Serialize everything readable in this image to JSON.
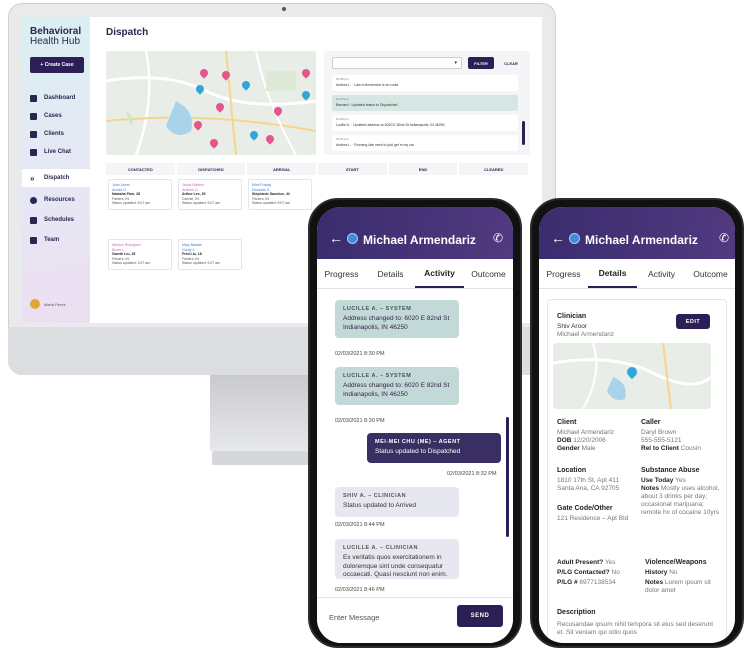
{
  "app": {
    "brand_line1": "Behavioral",
    "brand_line2": "Health Hub",
    "create_case": "+ Create Case",
    "nav": [
      "Dashboard",
      "Cases",
      "Clients",
      "Live Chat",
      "Dispatch",
      "Resources",
      "Schedules",
      "Team"
    ],
    "user_name": "Maria Perez",
    "page_title": "Dispatch",
    "filter_btn": "FILTER",
    "clear_btn": "CLEAR",
    "log": [
      {
        "time": "10:35 pm",
        "msg": "Andrea L. · Law enforcement is en route"
      },
      {
        "time": "10:34 pm",
        "msg": "Bernard · Updated status to Dispatched"
      },
      {
        "time": "10:33 pm",
        "msg": "Lucille A. · Updated address to 6020 E 82nd St Indianapolis, IN 46250"
      },
      {
        "time": "10:31 pm",
        "msg": "Andrea L. · Running late need to just get in my car"
      }
    ],
    "statuses": [
      "CONTACTED",
      "DISPATCHED",
      "ARRIVAL",
      "START",
      "END",
      "CLEARED"
    ],
    "cards": [
      {
        "l1": "John Jones",
        "l2": "Arnold O.",
        "name": "Natasha Pion, 28",
        "city": "Fishers, IN",
        "status": "Status updated: 5:07 am"
      },
      {
        "l1": "Jacob Winters",
        "l2": "Andrew O.",
        "name": "Arthur Lee, 30",
        "city": "Carmel, IN",
        "status": "Status updated: 5:07 am"
      },
      {
        "l1": "Mimi Fostag",
        "l2": "Edwards G.",
        "name": "Stephanie Sanchez, 44",
        "city": "Fishers, IN",
        "status": "Status updated: 5:07 am"
      },
      {
        "l1": "Weston Rodriguez",
        "l2": "Bruce L.",
        "name": "Gareth Liu, 25",
        "city": "Fishers, IN",
        "status": "Status updated: 3:07 am"
      },
      {
        "l1": "Mary Balaski",
        "l2": "Gordy J.",
        "name": "Fred Liu, 18",
        "city": "Fishers, IN",
        "status": "Status updated: 5:07 am"
      }
    ]
  },
  "phone1": {
    "name": "Michael Armendariz",
    "tabs": [
      "Progress",
      "Details",
      "Activity",
      "Outcome"
    ],
    "messages": [
      {
        "header": "LUCILLE A. – SYSTEM",
        "body": "Address changed to: 6020 E 82nd St Indianapolis, IN 46250",
        "ts": "02/03/2021 8:30 PM"
      },
      {
        "header": "LUCILLE A. – SYSTEM",
        "body": "Address changed to: 6020 E 82nd St Indianapolis, IN 46250",
        "ts": "02/03/2021 8:30 PM"
      },
      {
        "header": "MEI-MEI CHU (ME) – AGENT",
        "body": "Status updated to Dispatched",
        "ts": "02/03/2021 8:32 PM"
      },
      {
        "header": "SHIV A. – CLINICIAN",
        "body": "Status updated to Arrived",
        "ts": "02/03/2021 8:44 PM"
      },
      {
        "header": "LUCILLE A. – CLINICIAN",
        "body": "Ex veritatis quos exercitationem in doloremque sint unde consequatur occaecati. Quasi nesciunt non enim.",
        "ts": "02/03/2021 8:46 PM"
      }
    ],
    "input_placeholder": "Enter Message",
    "send": "SEND"
  },
  "phone2": {
    "name": "Michael Armendariz",
    "tabs": [
      "Progress",
      "Details",
      "Activity",
      "Outcome"
    ],
    "clinician_label": "Clinician",
    "clinician_name": "Shiv Aroor",
    "clinician_client": "Michael Armendariz",
    "edit": "EDIT",
    "client_label": "Client",
    "client_name": "Michael Armendariz",
    "dob_label": "DOB",
    "dob": "12/20/2006",
    "gender_label": "Gender",
    "gender": "Male",
    "caller_label": "Caller",
    "caller_name": "Daryl Brown",
    "caller_phone": "555-555-5121",
    "rel_label": "Rel to Client",
    "rel": "Cousin",
    "location_label": "Location",
    "location": "1810 17th St, Apt 411 Santa Ana, CA 92705",
    "gate_label": "Gate Code/Other",
    "gate": "121 Residence – Apt Bld",
    "substance_label": "Substance Abuse",
    "use_today_label": "Use Today",
    "use_today": "Yes",
    "notes_label": "Notes",
    "substance_notes": "Mostly uses alcohol, about 3 drinks per day; occasional marijuana; remote hx of cocaine 10yrs",
    "adult_label": "Adult Present?",
    "adult": "Yes",
    "plg_contacted_label": "P/LG Contacted?",
    "plg_contacted": "No",
    "plg_num_label": "P/LG #",
    "plg_num": "6977138534",
    "violence_label": "Violence/Weapons",
    "history_label": "History",
    "history": "No",
    "violence_notes": "Lorem ipsum sit dolor amet",
    "description_label": "Description",
    "description": "Recusandae ipsum nihil tempora sit eius sed deserunt et. Sit veniam qui odio quos"
  },
  "colors": {
    "brand": "#2c1f55",
    "header": "#3a2c6e",
    "map_pin": "#e2558f",
    "map_pin_blue": "#2fa6d8",
    "system_msg": "#c3d9d8"
  }
}
